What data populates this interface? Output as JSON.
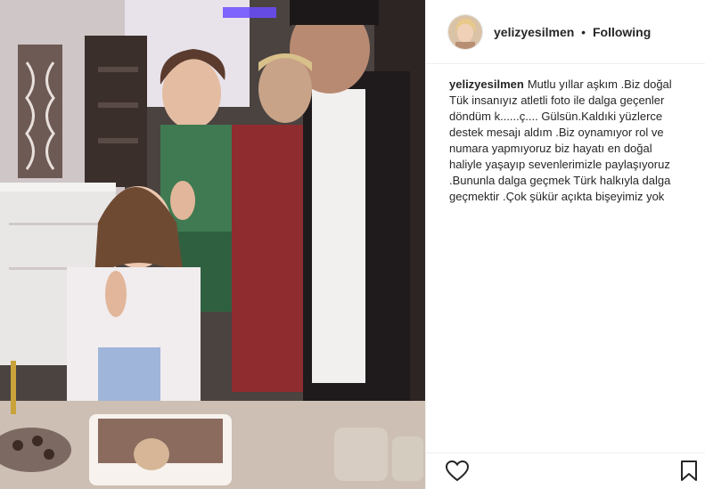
{
  "post": {
    "username": "yelizyesilmen",
    "separator": "•",
    "follow_status": "Following",
    "caption": "Mutlu yıllar aşkım .Biz doğal Tük insanıyız atletli foto ile dalga geçenler döndüm k......ç.... Gülsün.Kaldıki yüzlerce destek mesajı aldım .Biz oynamıyor rol ve numara yapmıyoruz biz hayatı en doğal haliyle yaşayıp sevenlerimizle paylaşıyoruz .Bununla dalga geçmek Türk halkıyla dalga geçmektir .Çok şükür açıkta bişeyimiz yok"
  },
  "icons": {
    "like": "heart-icon",
    "save": "bookmark-icon"
  },
  "colors": {
    "text": "#262626",
    "border": "#efefef"
  }
}
